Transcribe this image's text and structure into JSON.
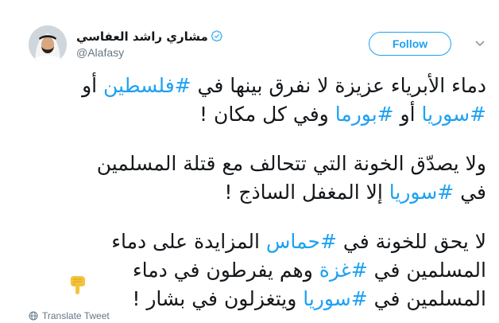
{
  "user": {
    "display_name": "مشاري راشد العفاسي",
    "handle": "@Alafasy",
    "verified_icon": "verified-badge-icon"
  },
  "actions": {
    "follow_label": "Follow",
    "more_icon": "chevron-down-icon"
  },
  "tweet": {
    "paragraphs": [
      {
        "lines": [
          [
            {
              "text": "دماء الأبرياء عزيزة لا نفرق بينها في ",
              "tag": false
            },
            {
              "text": "#فلسطين",
              "tag": true
            },
            {
              "text": " أو",
              "tag": false
            }
          ],
          [
            {
              "text": "#سوريا",
              "tag": true
            },
            {
              "text": " أو ",
              "tag": false
            },
            {
              "text": "#بورما",
              "tag": true
            },
            {
              "text": " وفي كل مكان !",
              "tag": false
            }
          ]
        ]
      },
      {
        "lines": [
          [
            {
              "text": "ولا يصدّق الخونة التي تتحالف مع قتلة المسلمين",
              "tag": false
            }
          ],
          [
            {
              "text": "في ",
              "tag": false
            },
            {
              "text": "#سوريا",
              "tag": true
            },
            {
              "text": " إلا المغفل الساذج !",
              "tag": false
            }
          ]
        ]
      },
      {
        "lines": [
          [
            {
              "text": "لا يحق للخونة في ",
              "tag": false
            },
            {
              "text": "#حماس",
              "tag": true
            },
            {
              "text": " المزايدة على دماء",
              "tag": false
            }
          ],
          [
            {
              "text": "المسلمين في ",
              "tag": false
            },
            {
              "text": "#غزة",
              "tag": true
            },
            {
              "text": " وهم يفرطون في دماء",
              "tag": false
            }
          ],
          [
            {
              "text": "المسلمين في ",
              "tag": false
            },
            {
              "text": "#سوريا",
              "tag": true
            },
            {
              "text": " ويتغزلون في بشار !",
              "tag": false
            }
          ]
        ]
      }
    ],
    "emoji": "pointing-down-hand-icon"
  },
  "footer": {
    "translate_label": "Translate Tweet",
    "globe_icon": "globe-icon"
  },
  "colors": {
    "accent": "#1da1f2",
    "text": "#14171a",
    "muted": "#657786"
  }
}
